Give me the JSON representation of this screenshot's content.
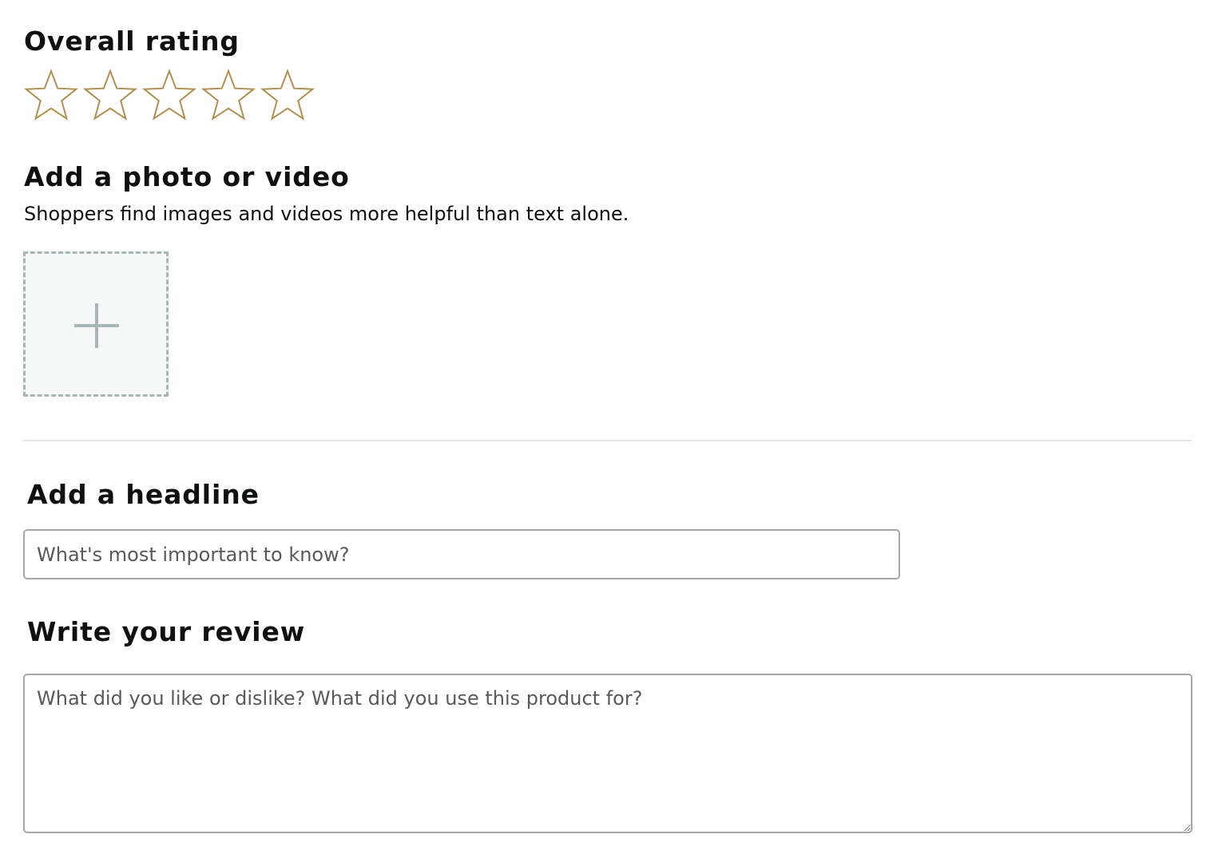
{
  "rating": {
    "heading": "Overall rating",
    "max_stars": 5,
    "selected": 0,
    "star_color": "#b38f4f",
    "star_icon": "star-outline-icon"
  },
  "media": {
    "heading": "Add a photo or video",
    "description": "Shoppers find images and videos more helpful than text alone.",
    "upload_icon": "plus-icon"
  },
  "headline": {
    "heading": "Add a headline",
    "placeholder": "What's most important to know?",
    "value": ""
  },
  "review": {
    "heading": "Write your review",
    "placeholder": "What did you like or dislike? What did you use this product for?",
    "value": ""
  }
}
